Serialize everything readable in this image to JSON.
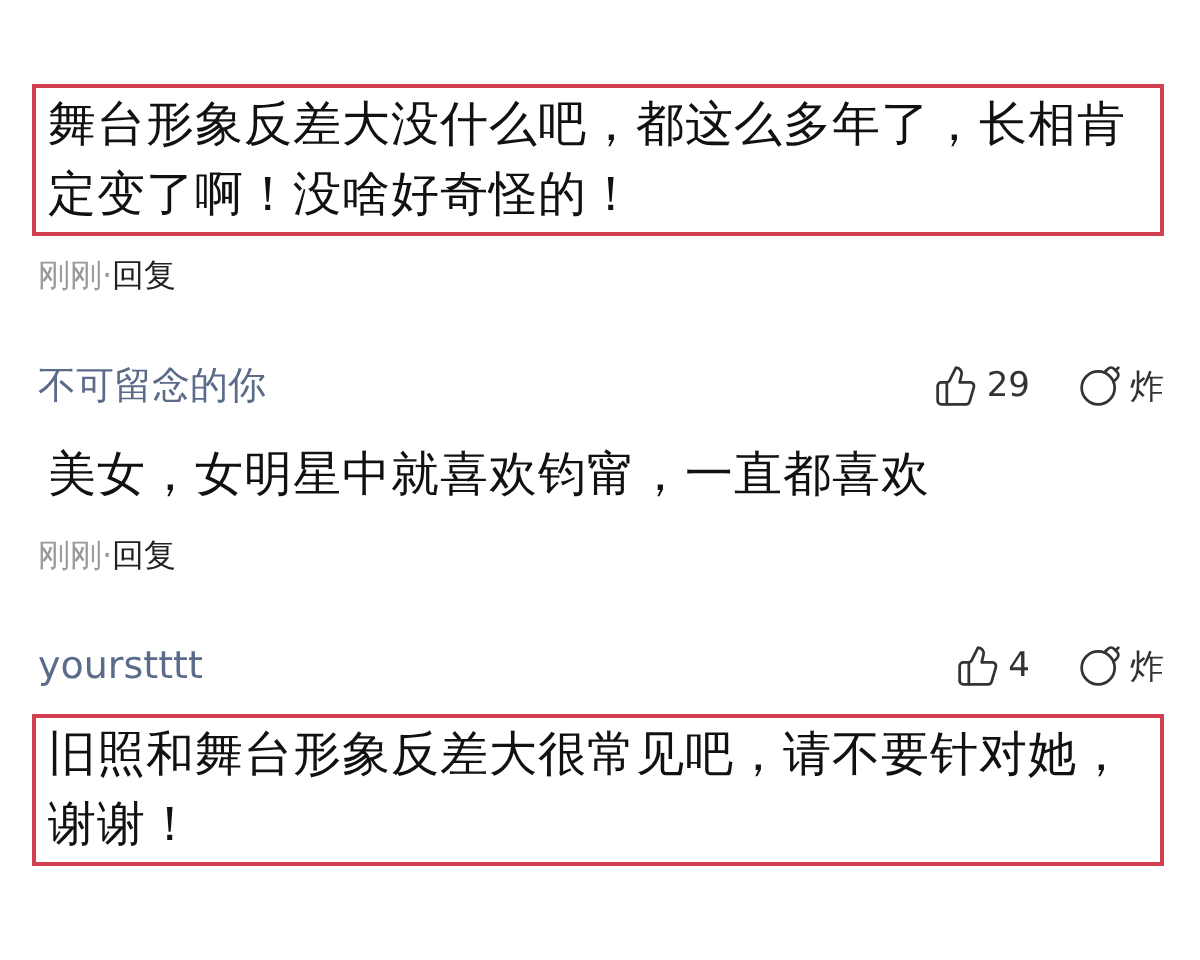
{
  "comments": [
    {
      "text": "舞台形象反差大没什么吧，都这么多年了，长相肯定变了啊！没啥好奇怪的！",
      "highlighted": true,
      "time": "刚刚",
      "separator": "·",
      "reply": "回复"
    },
    {
      "username": "不可留念的你",
      "likes": "29",
      "dislike": "炸",
      "text": "美女，女明星中就喜欢钧甯，一直都喜欢",
      "highlighted": false,
      "time": "刚刚",
      "separator": "·",
      "reply": "回复"
    },
    {
      "username": "yourstttt",
      "likes": "4",
      "dislike": "炸",
      "text": "旧照和舞台形象反差大很常见吧，请不要针对她，谢谢！",
      "highlighted": true
    }
  ]
}
